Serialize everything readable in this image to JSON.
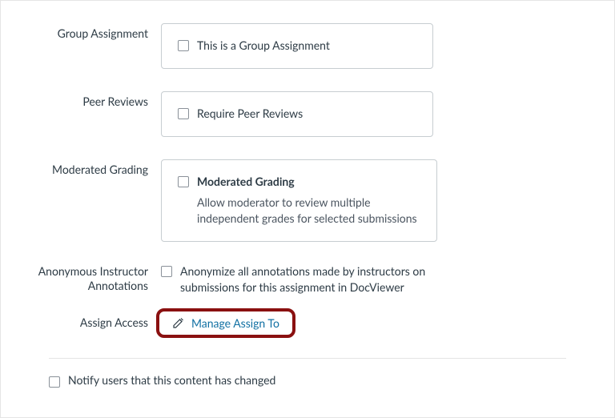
{
  "group": {
    "label": "Group Assignment",
    "checkbox_label": "This is a Group Assignment"
  },
  "peer": {
    "label": "Peer Reviews",
    "checkbox_label": "Require Peer Reviews"
  },
  "moderated": {
    "label": "Moderated Grading",
    "checkbox_label": "Moderated Grading",
    "description": "Allow moderator to review multiple independent grades for selected submissions"
  },
  "anonymous": {
    "label_line1": "Anonymous Instructor",
    "label_line2": "Annotations",
    "checkbox_label": "Anonymize all annotations made by instructors on",
    "checkbox_label_line2": "submissions for this assignment in DocViewer"
  },
  "assign": {
    "label": "Assign Access",
    "link_text": "Manage Assign To"
  },
  "notify": {
    "checkbox_label": "Notify users that this content has changed"
  },
  "colors": {
    "link": "#1170a3",
    "highlight_ring": "#8a1010"
  }
}
